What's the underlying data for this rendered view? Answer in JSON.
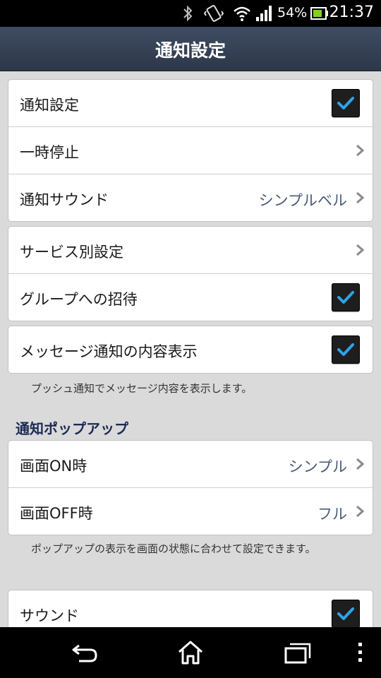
{
  "status_bar": {
    "battery_percent": "54%",
    "time": "21:37",
    "icons": [
      "bluetooth-icon",
      "vibrate-icon",
      "wifi-icon",
      "signal-icon",
      "battery-icon"
    ]
  },
  "header": {
    "title": "通知設定"
  },
  "group1": {
    "notifications": {
      "label": "通知設定",
      "checked": true
    },
    "pause": {
      "label": "一時停止"
    },
    "sound": {
      "label": "通知サウンド",
      "value": "シンプルベル"
    }
  },
  "group2": {
    "per_service": {
      "label": "サービス別設定"
    },
    "group_invite": {
      "label": "グループへの招待",
      "checked": true
    }
  },
  "group3": {
    "message_preview": {
      "label": "メッセージ通知の内容表示",
      "checked": true
    }
  },
  "note_push": "プッシュ通知でメッセージ内容を表示します。",
  "popup_section": {
    "header": "通知ポップアップ",
    "screen_on": {
      "label": "画面ON時",
      "value": "シンプル"
    },
    "screen_off": {
      "label": "画面OFF時",
      "value": "フル"
    },
    "note": "ポップアップの表示を画面の状態に合わせて設定できます。"
  },
  "group5": {
    "sound": {
      "label": "サウンド",
      "checked": true
    }
  },
  "colors": {
    "title_bar": "#333d51",
    "check_mark": "#2fa3e6",
    "value_text": "#4a5b79",
    "section_header": "#1d2b52"
  }
}
